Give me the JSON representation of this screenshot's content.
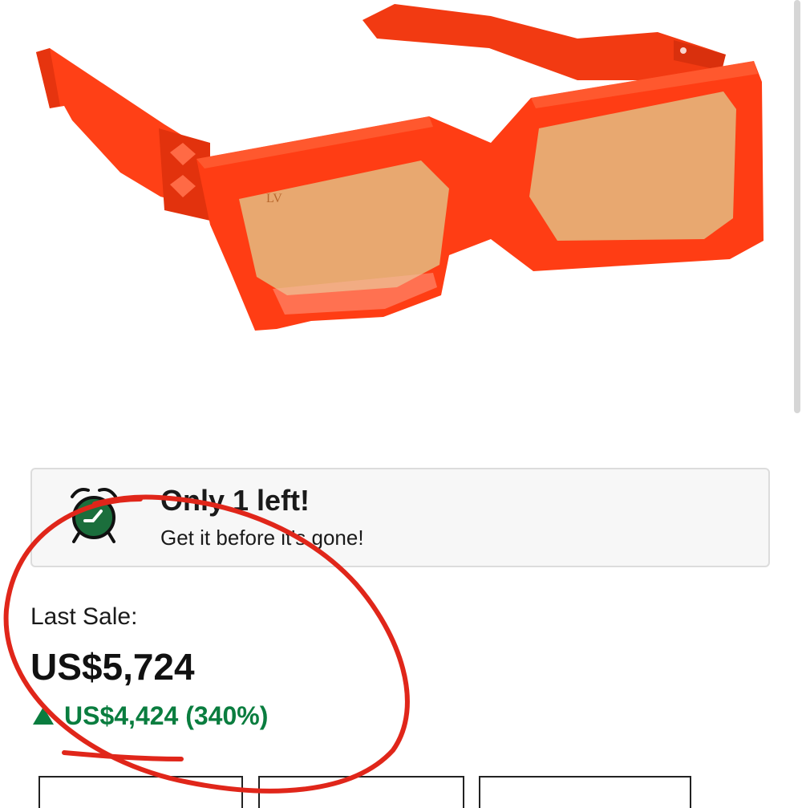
{
  "product": {
    "image_alt": "Orange square sunglasses",
    "logo_text": "LV"
  },
  "alert": {
    "title": "Only 1 left!",
    "subtitle": "Get it before it's gone!",
    "icon": "alarm-clock-icon"
  },
  "last_sale": {
    "label": "Last Sale:",
    "price": "US$5,724",
    "change": "US$4,424 (340%)",
    "change_icon": "up-arrow-icon",
    "change_color": "#0a7d3f"
  },
  "colors": {
    "frame": "#ff3d14",
    "lens": "#e8a870",
    "annotation": "#e0261a",
    "accent_green": "#0a7d3f"
  }
}
